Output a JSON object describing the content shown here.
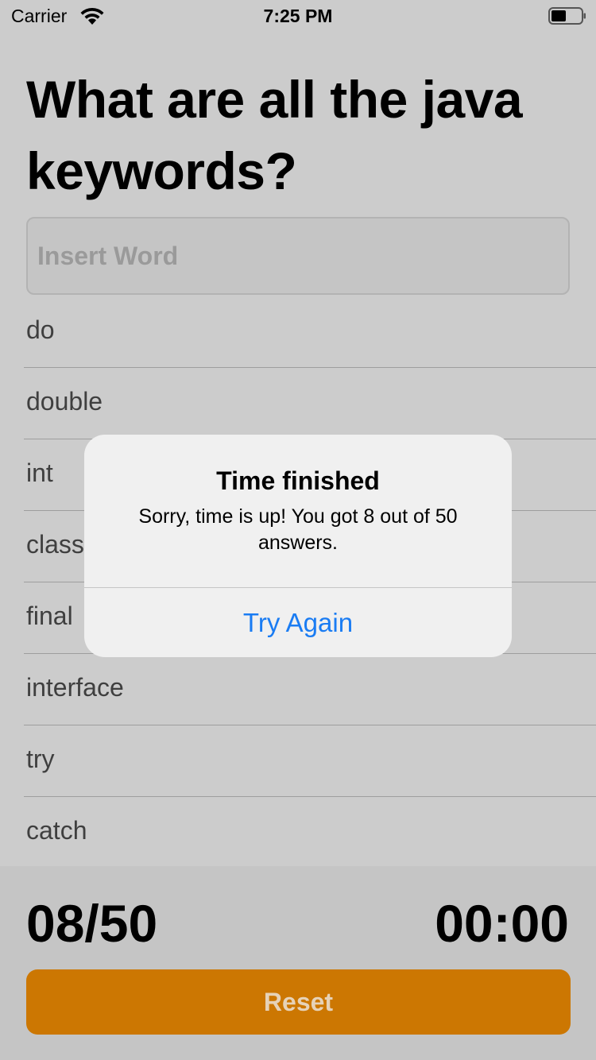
{
  "status_bar": {
    "carrier": "Carrier",
    "time": "7:25 PM",
    "wifi_icon": "wifi-icon",
    "battery_icon": "battery-icon"
  },
  "title": "What are all the java keywords?",
  "search": {
    "placeholder": "Insert Word",
    "value": ""
  },
  "words": [
    "do",
    "double",
    "int",
    "class",
    "final",
    "interface",
    "try",
    "catch"
  ],
  "footer": {
    "score": "08/50",
    "timer": "00:00",
    "reset_label": "Reset"
  },
  "alert": {
    "title": "Time finished",
    "message": "Sorry, time is up! You got 8 out of 50 answers.",
    "button_label": "Try Again"
  },
  "colors": {
    "accent": "#cc7702",
    "link": "#1a7cf3",
    "background": "#cccccc"
  }
}
